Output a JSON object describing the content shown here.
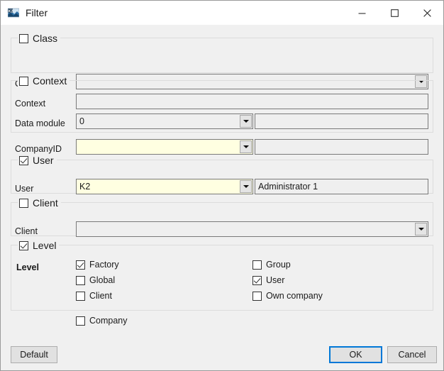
{
  "window": {
    "title": "Filter",
    "icon": "k2-app-icon",
    "controls": {
      "minimize": "minimize-icon",
      "maximize": "maximize-icon",
      "close": "close-icon"
    }
  },
  "colors": {
    "window_bg": "#f0f0f0",
    "titlebar_bg": "#ffffff",
    "field_bg": "#efefef",
    "field_highlight_bg": "#ffffe1",
    "group_border": "#dcdcdc",
    "field_border": "#7a7a7a",
    "accent": "#0078d7"
  },
  "groups": {
    "class": {
      "caption": "Class",
      "checked": false,
      "row_label": "Class",
      "combo_value": "",
      "combo_type": "dropdown"
    },
    "context": {
      "caption": "Context",
      "checked": false,
      "context_label": "Context",
      "context_value": "",
      "data_module_label": "Data module",
      "data_module_value": "0",
      "data_module_desc": ""
    },
    "company_id": {
      "label": "CompanyID",
      "value": "",
      "desc": ""
    },
    "user": {
      "caption": "User",
      "checked": true,
      "row_label": "User",
      "combo_value": "K2",
      "desc_value": "Administrator 1"
    },
    "client": {
      "caption": "Client",
      "checked": false,
      "row_label": "Client",
      "combo_value": ""
    },
    "level": {
      "caption": "Level",
      "checked": true,
      "row_label": "Level",
      "left_items": [
        {
          "label": "Factory",
          "checked": true
        },
        {
          "label": "Global",
          "checked": false
        },
        {
          "label": "Client",
          "checked": false
        }
      ],
      "right_items": [
        {
          "label": "Group",
          "checked": false
        },
        {
          "label": "User",
          "checked": true
        },
        {
          "label": "Own company",
          "checked": false
        }
      ]
    },
    "company": {
      "label": "Company",
      "checked": false
    }
  },
  "footer": {
    "default_label": "Default",
    "ok_label": "OK",
    "cancel_label": "Cancel"
  }
}
